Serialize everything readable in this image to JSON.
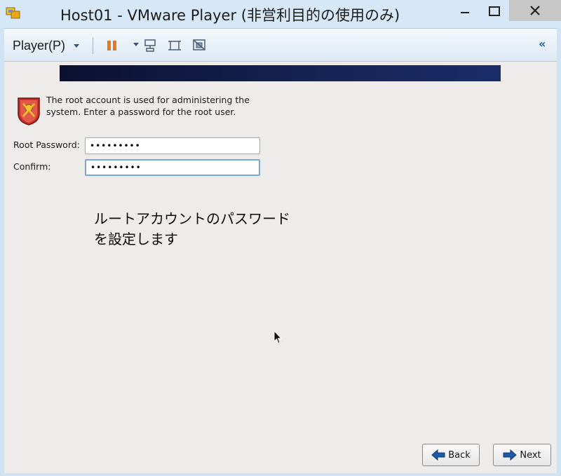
{
  "window": {
    "title": "Host01 - VMware Player (非営利目的の使用のみ)"
  },
  "toolbar": {
    "player_menu_label": "Player(P)",
    "icons": [
      "pause-icon",
      "send-ctrl-alt-del-icon",
      "fit-guest-icon",
      "unity-icon",
      "collapse-icon"
    ],
    "collapse_glyph": "«"
  },
  "guest": {
    "info_text": "The root account is used for administering the system.  Enter a password for the root user.",
    "root_password_label": "Root Password:",
    "root_password_value": "•••••••••",
    "confirm_label": "Confirm:",
    "confirm_value": "•••••••••",
    "annotation_line1": "ルートアカウントのパスワード",
    "annotation_line2": "を設定します",
    "back_label": "Back",
    "next_label": "Next"
  },
  "colors": {
    "titlebar_bg": "#d6e8f8",
    "guest_bg": "#edecea",
    "banner": "#152455",
    "pause_accent": "#e07b1f",
    "nav_arrow": "#1f5aa6"
  }
}
